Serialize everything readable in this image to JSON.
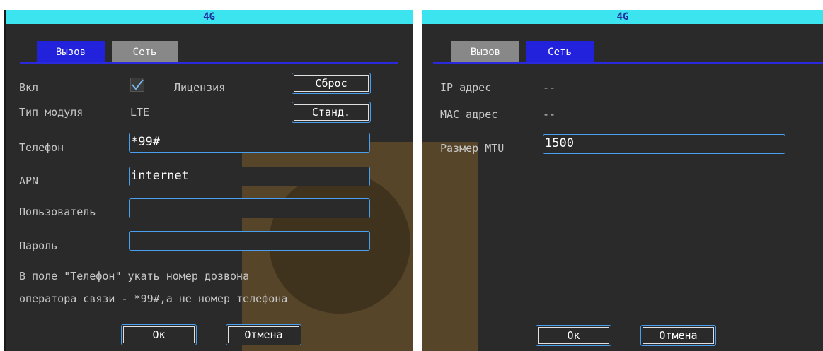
{
  "colors": {
    "title_bar": "#3ce4f0",
    "title_text": "#2030a0",
    "panel_bg": "#2a2a2a",
    "tab_active": "#2222dd",
    "tab_inactive": "#888888",
    "field_border": "#4aa0f0",
    "label_text": "#c8c8c8"
  },
  "left_dialog": {
    "title": "4G",
    "tabs": [
      {
        "label": "Вызов",
        "active": true
      },
      {
        "label": "Сеть",
        "active": false
      }
    ],
    "enable_label": "Вкл",
    "enable_checked": true,
    "license_label": "Лицензия",
    "reset_button": "Сброс",
    "module_type_label": "Тип модуля",
    "module_type_value": "LTE",
    "standard_button": "Станд.",
    "phone_label": "Телефон",
    "phone_value": "*99#",
    "apn_label": "APN",
    "apn_value": "internet",
    "user_label": "Пользователь",
    "user_value": "",
    "password_label": "Пароль",
    "password_value": "",
    "note_line1": "В поле \"Телефон\" укать номер дозвона",
    "note_line2": "оператора связи - *99#,а не номер телефона",
    "ok_button": "Ок",
    "cancel_button": "Отмена"
  },
  "right_dialog": {
    "title": "4G",
    "tabs": [
      {
        "label": "Вызов",
        "active": false
      },
      {
        "label": "Сеть",
        "active": true
      }
    ],
    "ip_label": "IP адрес",
    "ip_value": "--",
    "mac_label": "MAC адрес",
    "mac_value": "--",
    "mtu_label": "Размер MTU",
    "mtu_value": "1500",
    "ok_button": "Ок",
    "cancel_button": "Отмена"
  }
}
